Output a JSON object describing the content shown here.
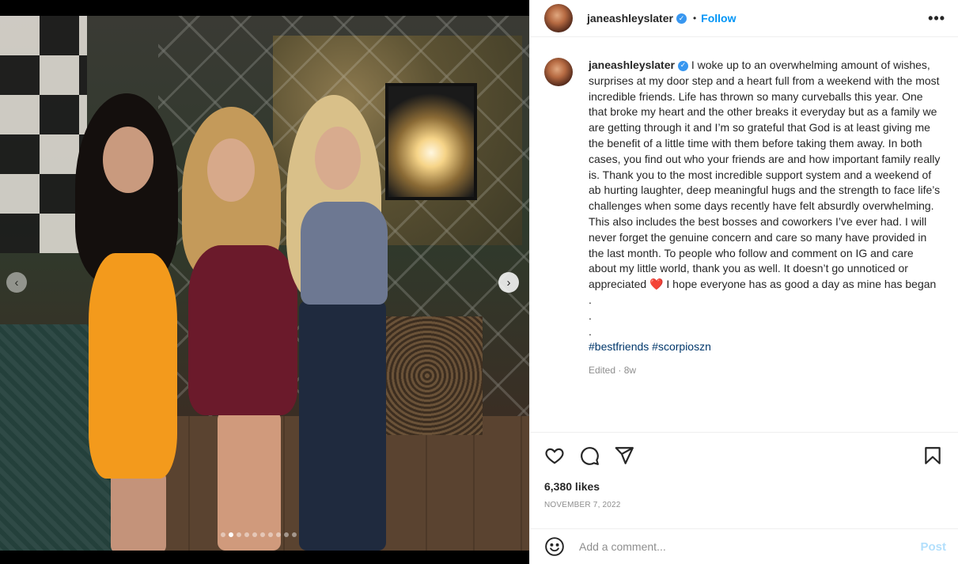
{
  "post": {
    "username": "janeashleyslater",
    "follow_label": "Follow",
    "separator": "•",
    "more_label": "•••",
    "caption": {
      "username": "janeashleyslater",
      "text": "I woke up to an overwhelming amount of wishes, surprises at my door step and a heart full from a weekend with the most incredible friends. Life has thrown so many curveballs this year. One that broke my heart and the other breaks it everyday but as a family we are getting through it and I’m so grateful that God is at least giving me the benefit of a little time with them before taking them away. In both cases, you find out who your friends are and how important family really is. Thank you to the most incredible support system and a weekend of ab hurting laughter, deep meaningful hugs and the strength to face life’s challenges when some days recently have felt absurdly overwhelming. This also includes the best bosses and coworkers I’ve ever had. I will never forget the genuine concern and care so many have provided in the last month. To people who follow and comment on IG and care about my little world, thank you as well. It doesn’t go unnoticed or appreciated",
      "heart_emoji": "❤️",
      "text_after_emoji": " I hope everyone has as good a day as mine has began",
      "dot_lines": [
        ".",
        ".",
        "."
      ],
      "hashtags": [
        "#bestfriends",
        "#scorpioszn"
      ]
    },
    "edited_label": "Edited",
    "edited_time": "8w",
    "likes": "6,380 likes",
    "date": "NOVEMBER 7, 2022",
    "comment_placeholder": "Add a comment...",
    "post_button": "Post"
  },
  "carousel": {
    "total": 10,
    "active_index": 1
  },
  "colors": {
    "accent": "#0095f6",
    "hashtag": "#00376b",
    "muted": "#8e8e8e",
    "post_disabled": "#b2dffc",
    "verified": "#3897f0"
  },
  "icons": [
    "heart-icon",
    "comment-icon",
    "share-icon",
    "bookmark-icon",
    "emoji-icon",
    "verified-icon",
    "chevron-left-icon",
    "chevron-right-icon"
  ]
}
